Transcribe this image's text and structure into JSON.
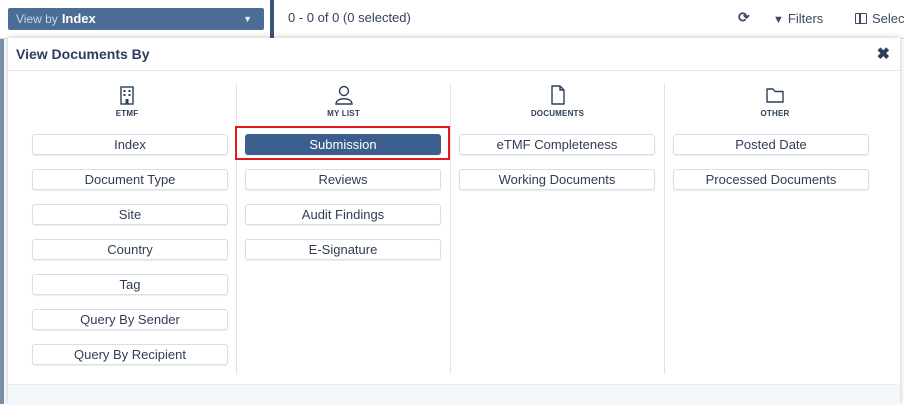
{
  "toolbar": {
    "view_by_prefix": "View by",
    "view_by_value": "Index",
    "count_text": "0 - 0 of 0 (0 selected)",
    "refresh_icon": "refresh-icon",
    "filters_label": "Filters",
    "select_label": "Selec"
  },
  "modal": {
    "title": "View Documents By",
    "close_icon": "close-icon",
    "columns": [
      {
        "heading": "ETMF",
        "icon": "building-icon",
        "options": [
          "Index",
          "Document Type",
          "Site",
          "Country",
          "Tag",
          "Query By Sender",
          "Query By Recipient"
        ]
      },
      {
        "heading": "MY LIST",
        "icon": "user-icon",
        "options": [
          "Submission",
          "Reviews",
          "Audit Findings",
          "E-Signature"
        ],
        "selected": "Submission"
      },
      {
        "heading": "DOCUMENTS",
        "icon": "document-icon",
        "options": [
          "eTMF Completeness",
          "Working Documents"
        ]
      },
      {
        "heading": "OTHER",
        "icon": "folder-icon",
        "options": [
          "Posted Date",
          "Processed Documents"
        ]
      }
    ]
  },
  "colors": {
    "accent": "#3b5e8c",
    "viewby_bg": "#4b6d95",
    "highlight": "#e01b1b"
  }
}
